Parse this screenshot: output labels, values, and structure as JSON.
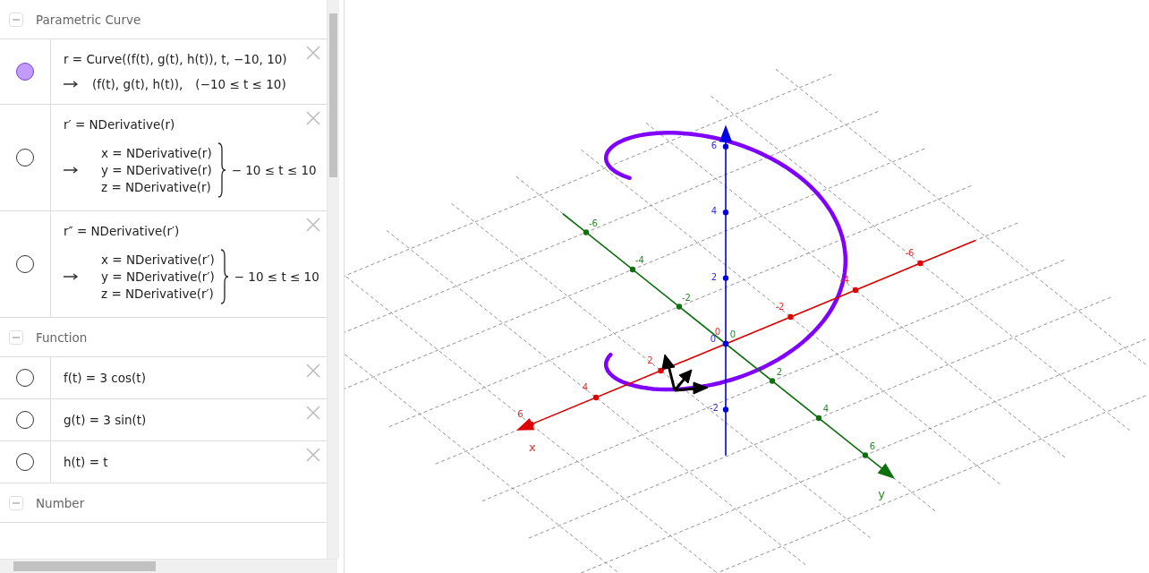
{
  "algebra": {
    "groups": [
      {
        "title": "Parametric Curve",
        "expanded": true,
        "items": [
          {
            "kind": "curve",
            "visible": true,
            "definition": "r = Curve((f(t), g(t), h(t)), t, −10, 10)",
            "value": "(f(t), g(t), h(t)),",
            "range": "(−10 ≤ t ≤ 10)"
          },
          {
            "kind": "system",
            "visible": false,
            "definition": "r′ = NDerivative(r)",
            "lines": [
              "x = NDerivative(r)",
              "y = NDerivative(r)",
              "z = NDerivative(r)"
            ],
            "range": "− 10 ≤ t ≤ 10"
          },
          {
            "kind": "system",
            "visible": false,
            "definition": "r″ = NDerivative(r′)",
            "lines": [
              "x = NDerivative(r′)",
              "y = NDerivative(r′)",
              "z = NDerivative(r′)"
            ],
            "range": "− 10 ≤ t ≤ 10"
          }
        ]
      },
      {
        "title": "Function",
        "expanded": true,
        "items": [
          {
            "kind": "plain",
            "visible": false,
            "definition": "f(t) = 3 cos(t)"
          },
          {
            "kind": "plain",
            "visible": false,
            "definition": "g(t) = 3 sin(t)"
          },
          {
            "kind": "plain",
            "visible": false,
            "definition": "h(t) = t"
          }
        ]
      },
      {
        "title": "Number",
        "expanded": true
      }
    ]
  },
  "graphics": {
    "axes": [
      {
        "kind": "x",
        "name": "x",
        "ticks": [
          "6",
          "4",
          "2",
          "0",
          "-2",
          "-4",
          "-6"
        ]
      },
      {
        "kind": "y",
        "name": "y",
        "ticks": [
          "-6",
          "-4",
          "-2",
          "0",
          "2",
          "4",
          "6"
        ]
      },
      {
        "kind": "z",
        "ticks": [
          "6",
          "4",
          "2",
          "0",
          "-2"
        ]
      }
    ]
  }
}
